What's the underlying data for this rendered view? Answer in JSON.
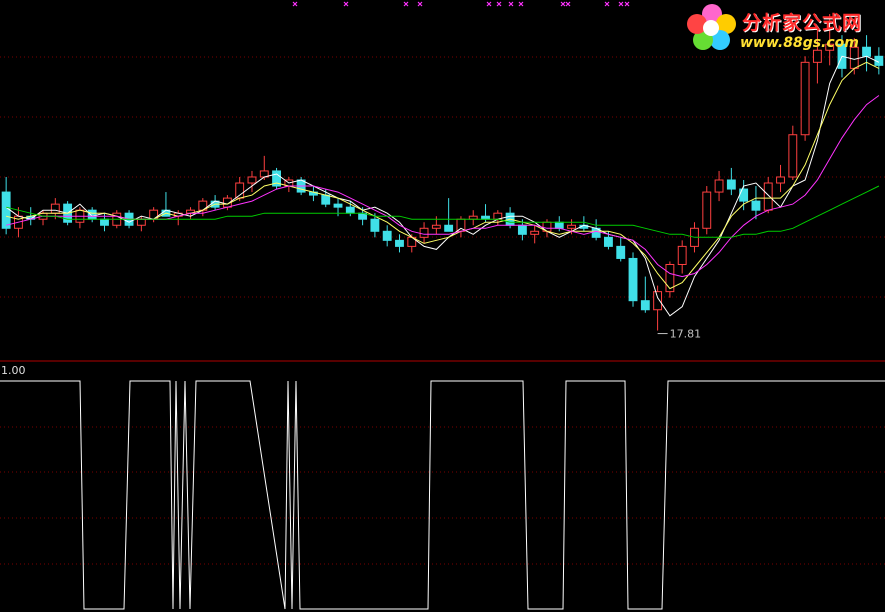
{
  "logo": {
    "title": "分析家公式网",
    "url": "www.88gs.com"
  },
  "colors": {
    "background": "#000000",
    "grid": "#7a0000",
    "divider": "#b00000",
    "candle_up": "#ff4040",
    "candle_down": "#40e0e8",
    "ma_short": "#ffffff",
    "ma_mid": "#ffff66",
    "ma_long": "#ff33ff",
    "ma_slow": "#00cc00",
    "signal_markers": "#ff33ff",
    "indicator_line": "#ffffff"
  },
  "chart_data": [
    {
      "type": "candlestick",
      "annotation": "17.81",
      "series": [
        {
          "values": [
            21.9,
            21.6,
            21.5,
            21.8,
            21.8,
            21.7,
            22.0,
            21.6,
            21.7,
            21.6,
            21.4,
            21.6,
            21.5,
            21.8,
            21.7,
            21.6,
            21.8,
            22.1,
            22.0,
            22.3,
            22.6,
            22.9,
            23.0,
            22.7,
            22.8,
            22.6,
            22.4,
            22.2,
            22.1,
            21.8,
            21.9,
            21.7,
            21.4,
            20.9,
            20.6,
            20.5,
            20.9,
            21.2,
            21.0,
            21.3,
            21.5,
            21.6,
            21.6,
            21.4,
            21.1,
            20.9,
            21.1,
            21.3,
            21.2,
            21.0,
            20.9,
            20.8,
            20.2,
            18.9,
            18.3,
            18.6,
            19.6,
            20.2,
            20.8,
            21.7,
            22.6,
            22.7,
            22.3,
            21.9,
            22.6,
            22.8,
            24.1,
            26.0,
            26.9,
            26.8,
            26.9,
            26.7
          ]
        },
        {
          "values": [
            21.6,
            21.5,
            21.6,
            21.7,
            21.7,
            21.7,
            21.8,
            21.7,
            21.7,
            21.6,
            21.5,
            21.5,
            21.5,
            21.7,
            21.6,
            21.7,
            21.8,
            22.0,
            22.0,
            22.2,
            22.3,
            22.6,
            22.7,
            22.6,
            22.5,
            22.4,
            22.3,
            22.2,
            22.0,
            21.8,
            21.6,
            21.4,
            21.1,
            20.9,
            20.7,
            20.8,
            20.9,
            21.1,
            21.2,
            21.4,
            21.4,
            21.5,
            21.4,
            21.3,
            21.1,
            21.0,
            21.1,
            21.1,
            21.1,
            21.1,
            21.0,
            20.7,
            20.3,
            19.7,
            19.2,
            19.4,
            19.9,
            20.4,
            20.9,
            21.6,
            22.0,
            22.2,
            22.2,
            22.2,
            22.6,
            23.3,
            24.3,
            25.3,
            26.1,
            26.5,
            26.7,
            26.5
          ]
        },
        {
          "values": [
            21.3,
            21.4,
            21.5,
            21.6,
            21.6,
            21.6,
            21.6,
            21.6,
            21.6,
            21.6,
            21.5,
            21.5,
            21.5,
            21.5,
            21.6,
            21.7,
            21.7,
            21.8,
            21.9,
            22.0,
            22.1,
            22.3,
            22.5,
            22.6,
            22.6,
            22.6,
            22.5,
            22.4,
            22.2,
            22.0,
            21.8,
            21.6,
            21.3,
            21.1,
            21.0,
            21.0,
            21.0,
            21.1,
            21.2,
            21.2,
            21.3,
            21.3,
            21.3,
            21.3,
            21.2,
            21.2,
            21.1,
            21.0,
            21.1,
            21.0,
            20.9,
            20.8,
            20.5,
            20.0,
            19.7,
            19.6,
            19.7,
            20.0,
            20.4,
            20.9,
            21.3,
            21.6,
            21.8,
            21.9,
            22.0,
            22.3,
            22.8,
            23.5,
            24.2,
            24.8,
            25.3,
            25.6
          ]
        },
        {
          "values": [
            21.9,
            21.8,
            21.7,
            21.6,
            21.6,
            21.5,
            21.5,
            21.5,
            21.5,
            21.5,
            21.5,
            21.5,
            21.5,
            21.5,
            21.5,
            21.5,
            21.5,
            21.5,
            21.6,
            21.6,
            21.6,
            21.7,
            21.7,
            21.7,
            21.7,
            21.7,
            21.7,
            21.7,
            21.7,
            21.7,
            21.6,
            21.6,
            21.6,
            21.5,
            21.5,
            21.5,
            21.5,
            21.5,
            21.5,
            21.5,
            21.5,
            21.4,
            21.4,
            21.4,
            21.4,
            21.4,
            21.4,
            21.4,
            21.3,
            21.3,
            21.3,
            21.3,
            21.2,
            21.1,
            21.0,
            21.0,
            20.9,
            20.9,
            20.9,
            20.9,
            21.0,
            21.0,
            21.1,
            21.1,
            21.2,
            21.4,
            21.6,
            21.8,
            22.0,
            22.2,
            22.4,
            22.6
          ]
        }
      ],
      "ohlc": [
        [
          22.4,
          22.9,
          21.0,
          21.2
        ],
        [
          21.2,
          21.9,
          20.9,
          21.6
        ],
        [
          21.6,
          21.9,
          21.3,
          21.5
        ],
        [
          21.5,
          21.8,
          21.3,
          21.7
        ],
        [
          21.7,
          22.2,
          21.5,
          22.0
        ],
        [
          22.0,
          22.1,
          21.3,
          21.4
        ],
        [
          21.4,
          21.9,
          21.2,
          21.8
        ],
        [
          21.8,
          21.9,
          21.4,
          21.5
        ],
        [
          21.5,
          21.7,
          21.1,
          21.3
        ],
        [
          21.3,
          21.8,
          21.2,
          21.7
        ],
        [
          21.7,
          21.8,
          21.2,
          21.3
        ],
        [
          21.3,
          21.6,
          21.1,
          21.5
        ],
        [
          21.5,
          21.9,
          21.4,
          21.8
        ],
        [
          21.8,
          22.4,
          21.6,
          21.6
        ],
        [
          21.6,
          21.8,
          21.3,
          21.7
        ],
        [
          21.7,
          21.9,
          21.5,
          21.8
        ],
        [
          21.8,
          22.2,
          21.6,
          22.1
        ],
        [
          22.1,
          22.3,
          21.8,
          21.9
        ],
        [
          21.9,
          22.3,
          21.8,
          22.2
        ],
        [
          22.2,
          22.9,
          22.1,
          22.7
        ],
        [
          22.7,
          23.1,
          22.4,
          22.9
        ],
        [
          22.9,
          23.6,
          22.8,
          23.1
        ],
        [
          23.1,
          23.2,
          22.5,
          22.6
        ],
        [
          22.6,
          22.9,
          22.4,
          22.8
        ],
        [
          22.8,
          22.9,
          22.3,
          22.4
        ],
        [
          22.4,
          22.6,
          22.1,
          22.3
        ],
        [
          22.3,
          22.5,
          21.9,
          22.0
        ],
        [
          22.0,
          22.2,
          21.6,
          21.9
        ],
        [
          21.9,
          22.1,
          21.6,
          21.7
        ],
        [
          21.7,
          21.9,
          21.3,
          21.5
        ],
        [
          21.5,
          21.7,
          20.9,
          21.1
        ],
        [
          21.1,
          21.3,
          20.6,
          20.8
        ],
        [
          20.8,
          21.0,
          20.4,
          20.6
        ],
        [
          20.6,
          21.0,
          20.4,
          20.9
        ],
        [
          20.9,
          21.4,
          20.7,
          21.2
        ],
        [
          21.2,
          21.6,
          21.0,
          21.3
        ],
        [
          21.3,
          22.2,
          21.1,
          21.1
        ],
        [
          21.1,
          21.6,
          20.9,
          21.5
        ],
        [
          21.5,
          21.8,
          21.3,
          21.6
        ],
        [
          21.6,
          22.0,
          21.4,
          21.5
        ],
        [
          21.5,
          21.8,
          21.3,
          21.7
        ],
        [
          21.7,
          21.9,
          21.2,
          21.3
        ],
        [
          21.3,
          21.5,
          20.8,
          21.0
        ],
        [
          21.0,
          21.3,
          20.7,
          21.1
        ],
        [
          21.1,
          21.5,
          20.9,
          21.4
        ],
        [
          21.4,
          21.6,
          21.1,
          21.2
        ],
        [
          21.2,
          21.5,
          21.0,
          21.3
        ],
        [
          21.3,
          21.6,
          21.1,
          21.2
        ],
        [
          21.2,
          21.5,
          20.8,
          20.9
        ],
        [
          20.9,
          21.1,
          20.5,
          20.6
        ],
        [
          20.6,
          20.9,
          20.1,
          20.2
        ],
        [
          20.2,
          20.4,
          18.6,
          18.8
        ],
        [
          18.8,
          19.6,
          18.4,
          18.5
        ],
        [
          18.5,
          19.3,
          17.81,
          19.1
        ],
        [
          19.1,
          20.1,
          18.9,
          20.0
        ],
        [
          20.0,
          20.8,
          19.7,
          20.6
        ],
        [
          20.6,
          21.4,
          20.4,
          21.2
        ],
        [
          21.2,
          22.6,
          21.0,
          22.4
        ],
        [
          22.4,
          23.1,
          22.1,
          22.8
        ],
        [
          22.8,
          23.2,
          22.3,
          22.5
        ],
        [
          22.5,
          22.8,
          21.8,
          22.1
        ],
        [
          22.1,
          22.6,
          21.5,
          21.8
        ],
        [
          21.8,
          22.9,
          21.7,
          22.7
        ],
        [
          22.7,
          23.3,
          22.4,
          22.9
        ],
        [
          22.9,
          24.6,
          22.8,
          24.3
        ],
        [
          24.3,
          26.9,
          24.1,
          26.7
        ],
        [
          26.7,
          27.9,
          26.0,
          27.1
        ],
        [
          27.1,
          28.3,
          26.6,
          27.3
        ],
        [
          27.3,
          27.6,
          26.2,
          26.5
        ],
        [
          26.5,
          27.5,
          26.3,
          27.2
        ],
        [
          27.2,
          27.6,
          26.4,
          26.9
        ],
        [
          26.9,
          27.2,
          26.3,
          26.6
        ]
      ],
      "signal_markers": [
        {
          "x": 295
        },
        {
          "x": 346
        },
        {
          "x": 406
        },
        {
          "x": 420
        },
        {
          "x": 489
        },
        {
          "x": 499
        },
        {
          "x": 511
        },
        {
          "x": 521
        },
        {
          "x": 563
        },
        {
          "x": 568
        },
        {
          "x": 607
        },
        {
          "x": 621
        },
        {
          "x": 627
        }
      ],
      "ylim": [
        17.0,
        28.6
      ]
    },
    {
      "type": "line",
      "ytick": "1.00",
      "ylim": [
        0,
        1
      ],
      "values": [
        1,
        1,
        1,
        1,
        1,
        1,
        0,
        0,
        0,
        0,
        0,
        0,
        1,
        1,
        1,
        1,
        0,
        1,
        0,
        1,
        0,
        1,
        1,
        1,
        1,
        1,
        1,
        0,
        1,
        0,
        1,
        0,
        0,
        0,
        0,
        0,
        0,
        0,
        0,
        0,
        0,
        1,
        1,
        1,
        1,
        1,
        1,
        1,
        1,
        0,
        0,
        0,
        0,
        0,
        1,
        1,
        1,
        1,
        1,
        1,
        0,
        0,
        0,
        0,
        1,
        1,
        1,
        1,
        1,
        1,
        1,
        1
      ],
      "x": [
        0,
        62,
        66,
        70,
        75,
        80,
        84,
        90,
        100,
        110,
        118,
        124,
        130,
        150,
        165,
        170,
        173,
        176,
        180,
        185,
        190,
        196,
        210,
        220,
        230,
        240,
        250,
        285,
        288,
        292,
        296,
        300,
        305,
        330,
        360,
        380,
        400,
        410,
        420,
        425,
        428,
        431,
        450,
        470,
        490,
        500,
        510,
        518,
        523,
        528,
        545,
        556,
        560,
        563,
        566,
        580,
        600,
        610,
        620,
        625,
        628,
        645,
        656,
        662,
        668,
        700,
        740,
        780,
        800,
        820,
        850,
        885
      ]
    }
  ]
}
